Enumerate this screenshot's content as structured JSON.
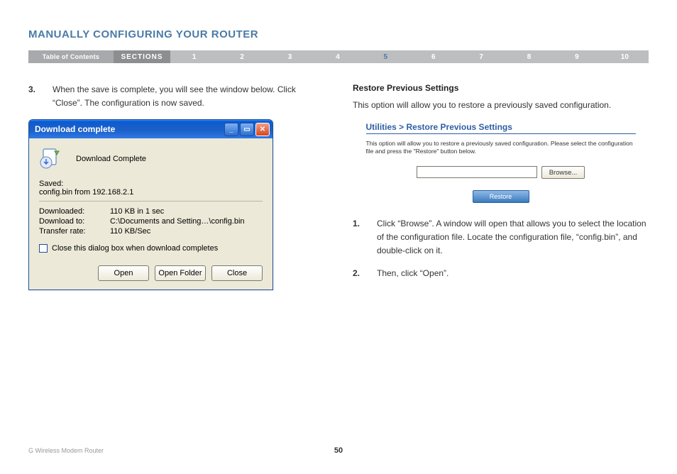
{
  "title": "MANUALLY CONFIGURING YOUR ROUTER",
  "nav": {
    "toc": "Table of Contents",
    "sections": "SECTIONS",
    "items": [
      "1",
      "2",
      "3",
      "4",
      "5",
      "6",
      "7",
      "8",
      "9",
      "10"
    ],
    "active_index": 4
  },
  "left": {
    "step_num": "3.",
    "step_text": "When the save is complete, you will see the window below. Click “Close”. The configuration is now saved.",
    "dialog": {
      "title": "Download complete",
      "heading": "Download Complete",
      "saved_label": "Saved:",
      "saved_value": "config.bin from 192.168.2.1",
      "rows": [
        {
          "k": "Downloaded:",
          "v": "110 KB in 1 sec"
        },
        {
          "k": "Download to:",
          "v": "C:\\Documents and Setting…\\config.bin"
        },
        {
          "k": "Transfer rate:",
          "v": "110 KB/Sec"
        }
      ],
      "checkbox": "Close this dialog box when download completes",
      "buttons": {
        "open": "Open",
        "open_folder": "Open Folder",
        "close": "Close"
      }
    }
  },
  "right": {
    "subhead": "Restore Previous Settings",
    "intro": "This option will allow you to restore a previously saved configuration.",
    "router": {
      "breadcrumb": "Utilities > Restore Previous Settings",
      "desc": "This option will allow you to restore a previously saved configuration. Please select the configuration file and press the \"Restore\" button below.",
      "browse": "Browse...",
      "restore": "Restore"
    },
    "steps": [
      {
        "n": "1.",
        "t": "Click “Browse”. A window will open that allows you to select the location of the configuration file. Locate the configuration file, “config.bin”, and double-click on it."
      },
      {
        "n": "2.",
        "t": "Then, click “Open”."
      }
    ]
  },
  "footer": {
    "product": "G Wireless Modem Router",
    "page": "50"
  }
}
